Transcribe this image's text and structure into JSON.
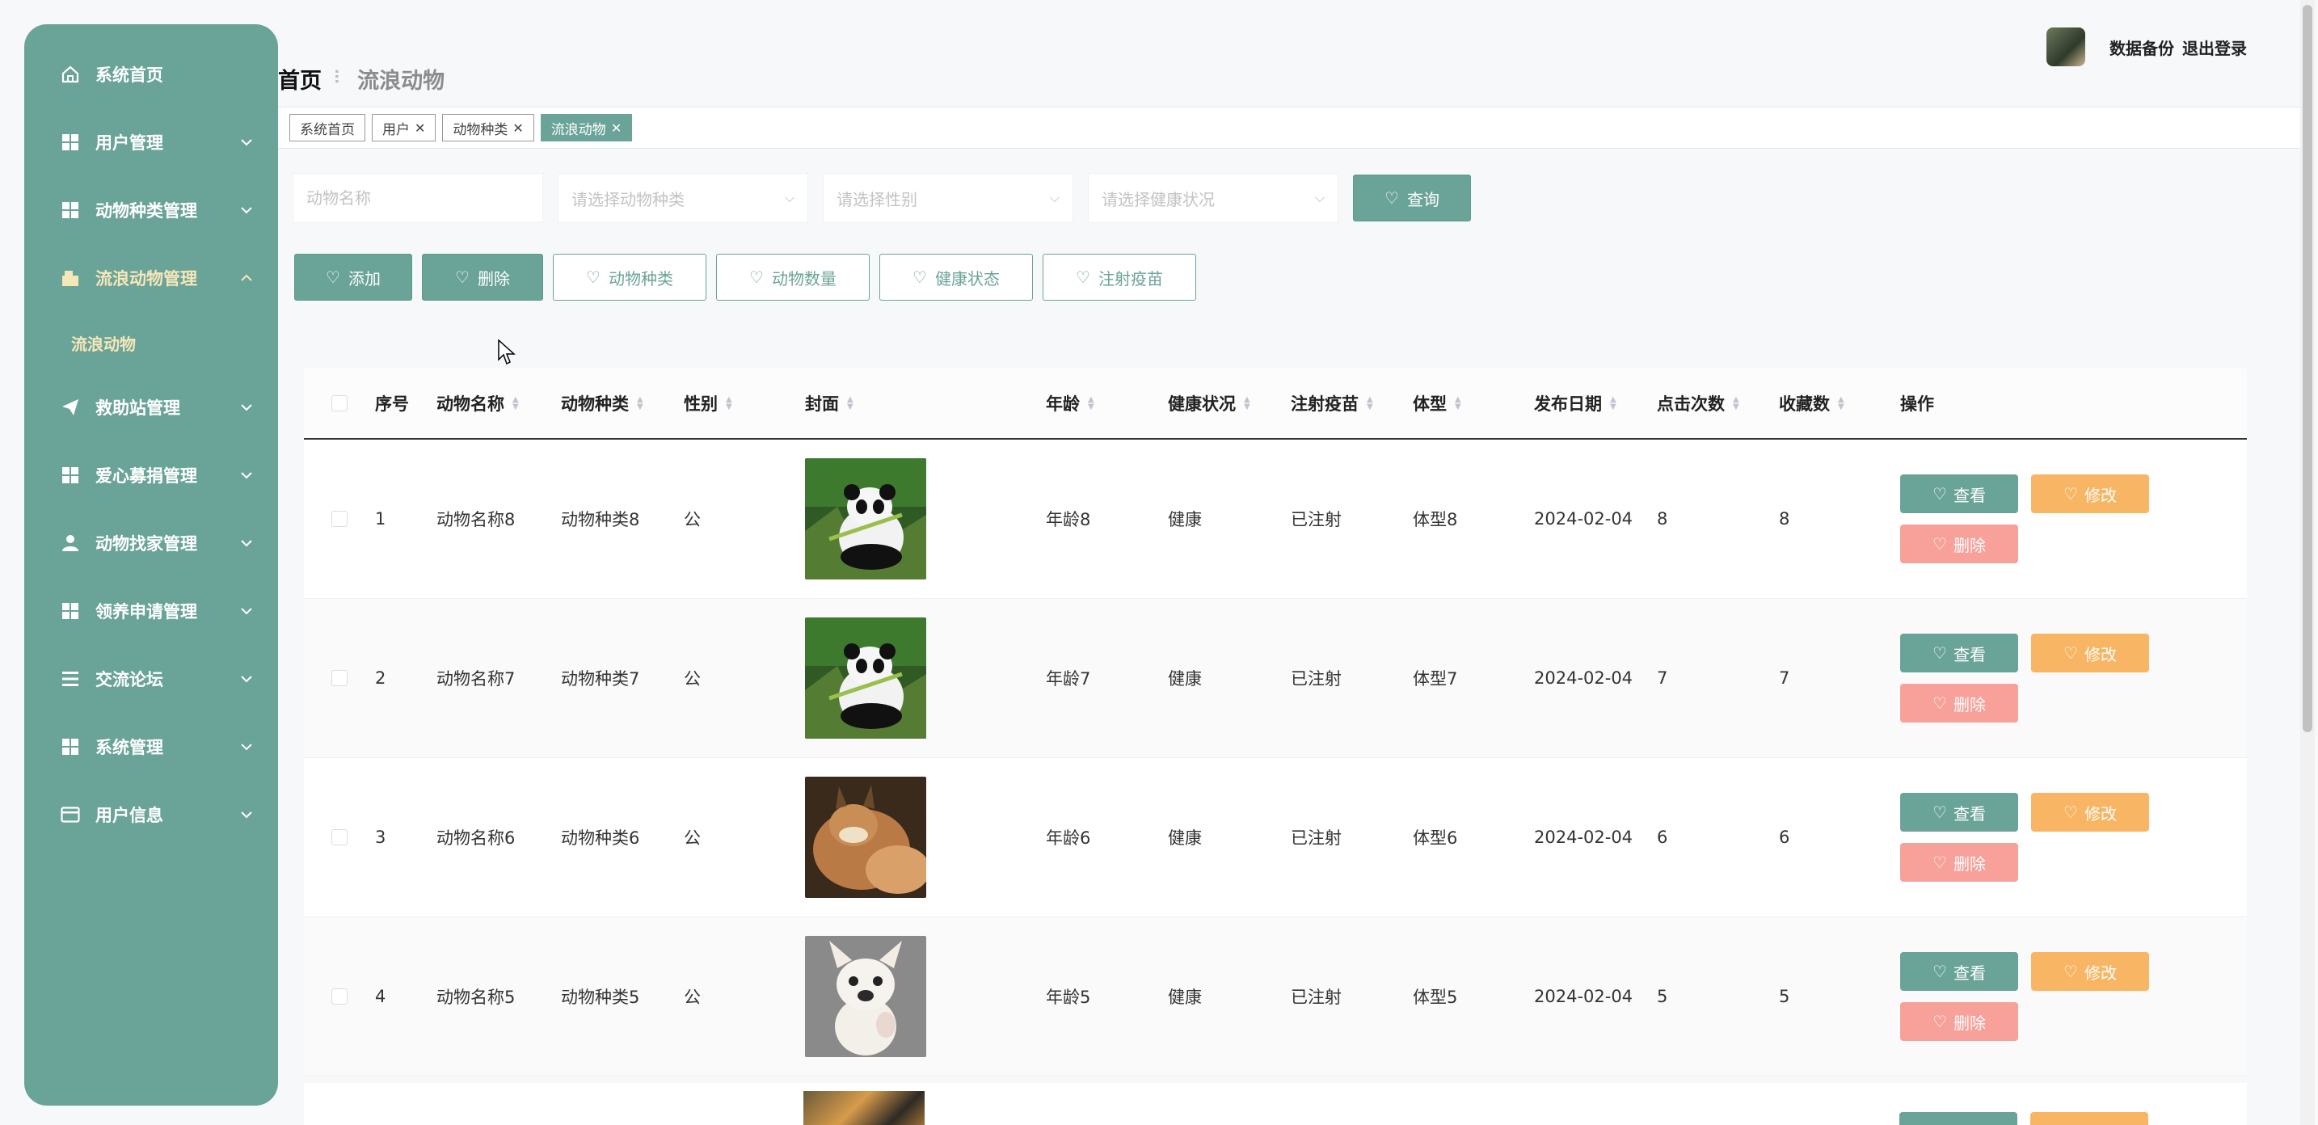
{
  "sidebar": {
    "items": [
      {
        "label": "系统首页",
        "icon": "home-icon"
      },
      {
        "label": "用户管理",
        "icon": "grid-icon"
      },
      {
        "label": "动物种类管理",
        "icon": "grid-icon"
      },
      {
        "label": "流浪动物管理",
        "icon": "cabinet-icon",
        "active": true,
        "sub": "流浪动物"
      },
      {
        "label": "救助站管理",
        "icon": "send-icon"
      },
      {
        "label": "爱心募捐管理",
        "icon": "grid-icon"
      },
      {
        "label": "动物找家管理",
        "icon": "user-icon"
      },
      {
        "label": "领养申请管理",
        "icon": "grid-icon"
      },
      {
        "label": "交流论坛",
        "icon": "list-icon"
      },
      {
        "label": "系统管理",
        "icon": "grid-icon"
      },
      {
        "label": "用户信息",
        "icon": "card-icon"
      }
    ]
  },
  "header": {
    "breadcrumb_home": "首页",
    "breadcrumb_sep": "⠇",
    "breadcrumb_current": "流浪动物",
    "backup_label": "数据备份",
    "logout_label": "退出登录"
  },
  "tags": [
    {
      "label": "系统首页",
      "closable": false,
      "active": false
    },
    {
      "label": "用户",
      "closable": true,
      "active": false
    },
    {
      "label": "动物种类",
      "closable": true,
      "active": false
    },
    {
      "label": "流浪动物",
      "closable": true,
      "active": true
    }
  ],
  "search": {
    "name_placeholder": "动物名称",
    "type_placeholder": "请选择动物种类",
    "sex_placeholder": "请选择性别",
    "health_placeholder": "请选择健康状况",
    "query_label": "查询"
  },
  "actions": {
    "add": "添加",
    "delete": "删除",
    "chart_type": "动物种类",
    "chart_count": "动物数量",
    "chart_health": "健康状态",
    "chart_vaccine": "注射疫苗"
  },
  "table": {
    "headers": [
      "序号",
      "动物名称",
      "动物种类",
      "性别",
      "封面",
      "年龄",
      "健康状况",
      "注射疫苗",
      "体型",
      "发布日期",
      "点击次数",
      "收藏数",
      "操作"
    ],
    "op_view": "查看",
    "op_edit": "修改",
    "op_del": "删除",
    "rows": [
      {
        "no": "1",
        "name": "动物名称8",
        "type": "动物种类8",
        "sex": "公",
        "cover": "panda",
        "age": "年龄8",
        "health": "健康",
        "vaccine": "已注射",
        "body": "体型8",
        "date": "2024-02-04",
        "clicks": "8",
        "favs": "8"
      },
      {
        "no": "2",
        "name": "动物名称7",
        "type": "动物种类7",
        "sex": "公",
        "cover": "panda",
        "age": "年龄7",
        "health": "健康",
        "vaccine": "已注射",
        "body": "体型7",
        "date": "2024-02-04",
        "clicks": "7",
        "favs": "7"
      },
      {
        "no": "3",
        "name": "动物名称6",
        "type": "动物种类6",
        "sex": "公",
        "cover": "lynx",
        "age": "年龄6",
        "health": "健康",
        "vaccine": "已注射",
        "body": "体型6",
        "date": "2024-02-04",
        "clicks": "6",
        "favs": "6"
      },
      {
        "no": "4",
        "name": "动物名称5",
        "type": "动物种类5",
        "sex": "公",
        "cover": "dog",
        "age": "年龄5",
        "health": "健康",
        "vaccine": "已注射",
        "body": "体型5",
        "date": "2024-02-04",
        "clicks": "5",
        "favs": "5"
      }
    ]
  },
  "colors": {
    "accent": "#6aa398",
    "edit": "#f8b664",
    "del": "#f8a19a",
    "active_text": "#f6e7b8"
  }
}
